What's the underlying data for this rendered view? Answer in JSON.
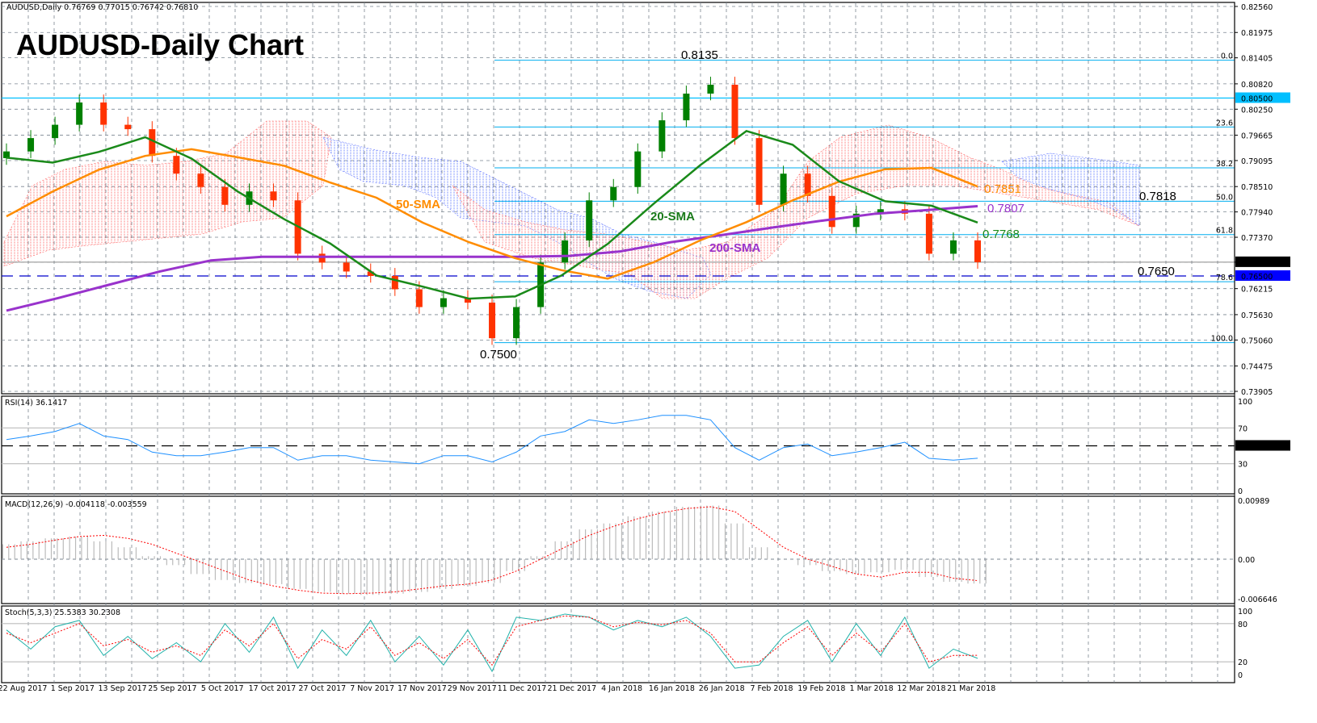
{
  "header": {
    "symbol_info": "AUDUSD,Daily  0.76769 0.77015 0.76742 0.76810",
    "title": "AUDUSD-Daily Chart"
  },
  "colors": {
    "bull": "#008000",
    "bear": "#ff3300",
    "sma20": "#1a8a1a",
    "sma50": "#ff8c00",
    "sma200": "#9933cc",
    "fib": "#00aeef",
    "rsi": "#1e90ff",
    "macd_signal": "#ff0000",
    "stoch_k": "#20b2aa",
    "stoch_d": "#ff0000"
  },
  "chart_data": [
    {
      "type": "candlestick",
      "title": "AUDUSD-Daily Chart",
      "x_tick_labels": [
        "22 Aug 2017",
        "1 Sep 2017",
        "13 Sep 2017",
        "25 Sep 2017",
        "5 Oct 2017",
        "17 Oct 2017",
        "27 Oct 2017",
        "7 Nov 2017",
        "17 Nov 2017",
        "29 Nov 2017",
        "11 Dec 2017",
        "21 Dec 2017",
        "4 Jan 2018",
        "16 Jan 2018",
        "26 Jan 2018",
        "7 Feb 2018",
        "19 Feb 2018",
        "1 Mar 2018",
        "12 Mar 2018",
        "21 Mar 2018"
      ],
      "y_tick_labels": [
        "0.82560",
        "0.81975",
        "0.81405",
        "0.80820",
        "0.80250",
        "0.79665",
        "0.79095",
        "0.78510",
        "0.77940",
        "0.77370",
        "0.76810",
        "0.76215",
        "0.75630",
        "0.75060",
        "0.74475",
        "0.73905"
      ],
      "ylim": [
        0.73905,
        0.8256
      ],
      "closes": [
        0.793,
        0.796,
        0.799,
        0.804,
        0.799,
        0.798,
        0.792,
        0.788,
        0.785,
        0.781,
        0.784,
        0.782,
        0.77,
        0.768,
        0.766,
        0.765,
        0.762,
        0.758,
        0.76,
        0.759,
        0.751,
        0.758,
        0.768,
        0.773,
        0.782,
        0.785,
        0.793,
        0.8,
        0.806,
        0.808,
        0.796,
        0.781,
        0.788,
        0.783,
        0.776,
        0.779,
        0.78,
        0.779,
        0.77,
        0.773,
        0.7681
      ],
      "sma20": [
        0.7916,
        0.7905,
        0.7929,
        0.7962,
        0.7914,
        0.784,
        0.7778,
        0.7723,
        0.7651,
        0.7626,
        0.7599,
        0.7604,
        0.7651,
        0.7722,
        0.7813,
        0.7899,
        0.7976,
        0.7945,
        0.7863,
        0.7818,
        0.7808,
        0.777
      ],
      "sma50": [
        0.7784,
        0.784,
        0.7889,
        0.792,
        0.7935,
        0.7917,
        0.7898,
        0.786,
        0.7826,
        0.777,
        0.7726,
        0.769,
        0.7663,
        0.7644,
        0.7681,
        0.773,
        0.7771,
        0.782,
        0.7862,
        0.789,
        0.7893,
        0.7851
      ],
      "sma200": [
        0.7572,
        0.76,
        0.763,
        0.766,
        0.7685,
        0.7693,
        0.7693,
        0.7693,
        0.7693,
        0.7693,
        0.7693,
        0.7695,
        0.7705,
        0.7726,
        0.7742,
        0.7759,
        0.7775,
        0.779,
        0.7798,
        0.7807
      ],
      "horizontal_levels": {
        "resistance": "0.80500",
        "support": "0.76500",
        "current": "0.76810",
        "support_value": 0.765,
        "resistance_value": 0.805,
        "current_value": 0.7681
      },
      "fibonacci": [
        {
          "label": "0.0",
          "price": 0.8135
        },
        {
          "label": "23.6",
          "price": 0.7985
        },
        {
          "label": "38.2",
          "price": 0.7893
        },
        {
          "label": "50.0",
          "price": 0.7818
        },
        {
          "label": "61.8",
          "price": 0.7743
        },
        {
          "label": "78.6",
          "price": 0.7637
        },
        {
          "label": "100.0",
          "price": 0.75
        }
      ],
      "annotations": {
        "high": "0.8135",
        "low": "0.7500",
        "sma50_label": "50-SMA",
        "sma20_label": "20-SMA",
        "sma200_label": "200-SMA",
        "sma50_value": "0.7851",
        "sma200_value": "0.7807",
        "sma20_value": "0.7768",
        "fib50_value": "0.7818",
        "support_value": "0.7650"
      }
    },
    {
      "type": "line",
      "title": "RSI(14) 36.1417",
      "ylim": [
        0,
        100
      ],
      "levels": [
        70,
        50,
        30
      ],
      "y_tick_labels": [
        "100",
        "70",
        "50.0000",
        "30",
        "0"
      ],
      "values": [
        57,
        61,
        66,
        75,
        61,
        57,
        43,
        39,
        39,
        43,
        48,
        48,
        34,
        39,
        39,
        34,
        32,
        30,
        39,
        39,
        32,
        43,
        61,
        66,
        79,
        75,
        79,
        84,
        84,
        79,
        48,
        34,
        48,
        52,
        39,
        43,
        48,
        54,
        36,
        34,
        36.14
      ]
    },
    {
      "type": "bar+line",
      "title": "MACD(12,26,9) -0.004118 -0.003559",
      "ylim": [
        -0.006646,
        0.00989
      ],
      "y_tick_labels": [
        "0.00989",
        "0.00",
        "-0.006646"
      ],
      "histogram": [
        0.0025,
        0.003,
        0.0035,
        0.0038,
        0.003,
        0.002,
        0.0005,
        -0.001,
        -0.0025,
        -0.0035,
        -0.004,
        -0.0042,
        -0.005,
        -0.0055,
        -0.0058,
        -0.006,
        -0.0058,
        -0.0055,
        -0.005,
        -0.0045,
        -0.004,
        -0.002,
        0.0005,
        0.003,
        0.005,
        0.006,
        0.0072,
        0.008,
        0.0088,
        0.009,
        0.006,
        0.002,
        0.0,
        -0.001,
        -0.002,
        -0.0025,
        -0.0022,
        -0.0018,
        -0.003,
        -0.0038,
        -0.0041
      ],
      "signal": [
        0.002,
        0.0025,
        0.0032,
        0.0038,
        0.004,
        0.0035,
        0.0025,
        0.001,
        -0.0005,
        -0.002,
        -0.0035,
        -0.0045,
        -0.0052,
        -0.0057,
        -0.0058,
        -0.0057,
        -0.0055,
        -0.005,
        -0.0045,
        -0.0042,
        -0.0035,
        -0.002,
        0.0,
        0.002,
        0.004,
        0.0055,
        0.0068,
        0.0078,
        0.0085,
        0.0088,
        0.008,
        0.005,
        0.002,
        0.0,
        -0.0012,
        -0.0025,
        -0.003,
        -0.0022,
        -0.0022,
        -0.0032,
        -0.0036
      ]
    },
    {
      "type": "line",
      "title": "Stoch(5,3,3) 25.5383 30.2308",
      "ylim": [
        0,
        100
      ],
      "levels": [
        80,
        20
      ],
      "y_tick_labels": [
        "100",
        "80",
        "20",
        "0"
      ],
      "k": [
        70,
        40,
        75,
        85,
        30,
        60,
        25,
        50,
        20,
        80,
        35,
        90,
        10,
        70,
        30,
        85,
        20,
        60,
        15,
        70,
        5,
        90,
        85,
        95,
        90,
        70,
        85,
        75,
        90,
        60,
        10,
        15,
        60,
        85,
        20,
        80,
        30,
        90,
        10,
        40,
        25.5
      ],
      "d": [
        65,
        50,
        65,
        80,
        45,
        55,
        35,
        45,
        30,
        70,
        45,
        80,
        25,
        55,
        40,
        75,
        30,
        50,
        25,
        55,
        15,
        75,
        85,
        92,
        90,
        75,
        82,
        78,
        85,
        65,
        20,
        20,
        50,
        75,
        30,
        65,
        35,
        80,
        20,
        30,
        30.2
      ]
    }
  ]
}
